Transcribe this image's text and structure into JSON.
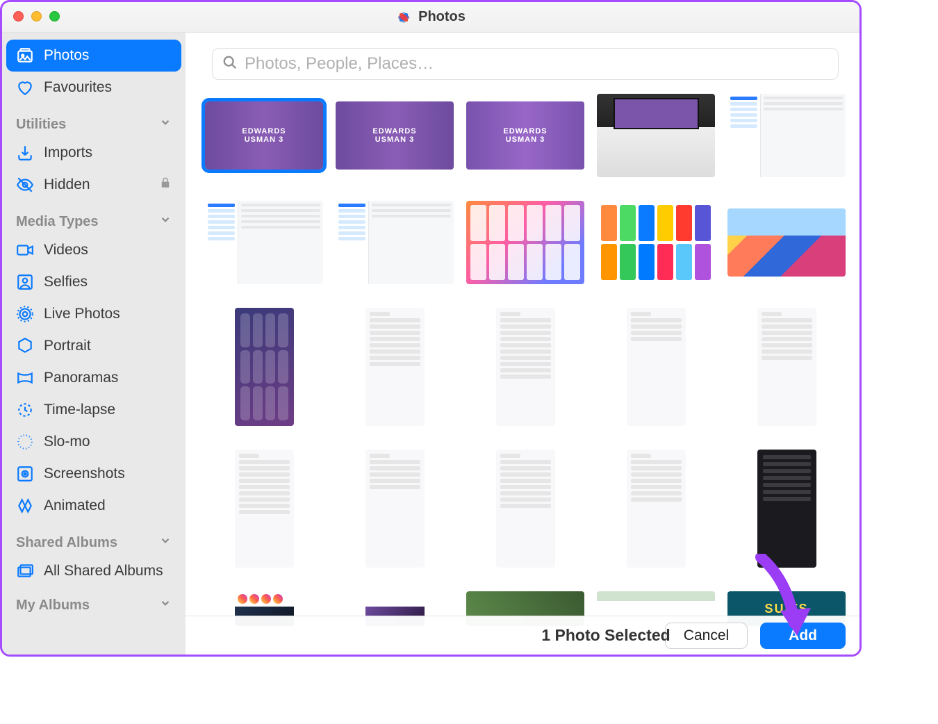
{
  "app": {
    "title": "Photos"
  },
  "search": {
    "placeholder": "Photos, People, Places…"
  },
  "sidebar": {
    "items": {
      "photos": "Photos",
      "favourites": "Favourites",
      "imports": "Imports",
      "hidden": "Hidden",
      "videos": "Videos",
      "selfies": "Selfies",
      "live_photos": "Live Photos",
      "portrait": "Portrait",
      "panoramas": "Panoramas",
      "time_lapse": "Time-lapse",
      "slo_mo": "Slo-mo",
      "screenshots": "Screenshots",
      "animated": "Animated",
      "all_shared_albums": "All Shared Albums"
    },
    "sections": {
      "utilities": "Utilities",
      "media_types": "Media Types",
      "shared_albums": "Shared Albums",
      "my_albums": "My Albums"
    }
  },
  "footer": {
    "status": "1 Photo Selected",
    "cancel": "Cancel",
    "add": "Add"
  },
  "thumb_text": {
    "edwards": "EDWARDS",
    "usman": "USMAN 3",
    "show": "SUITS"
  }
}
